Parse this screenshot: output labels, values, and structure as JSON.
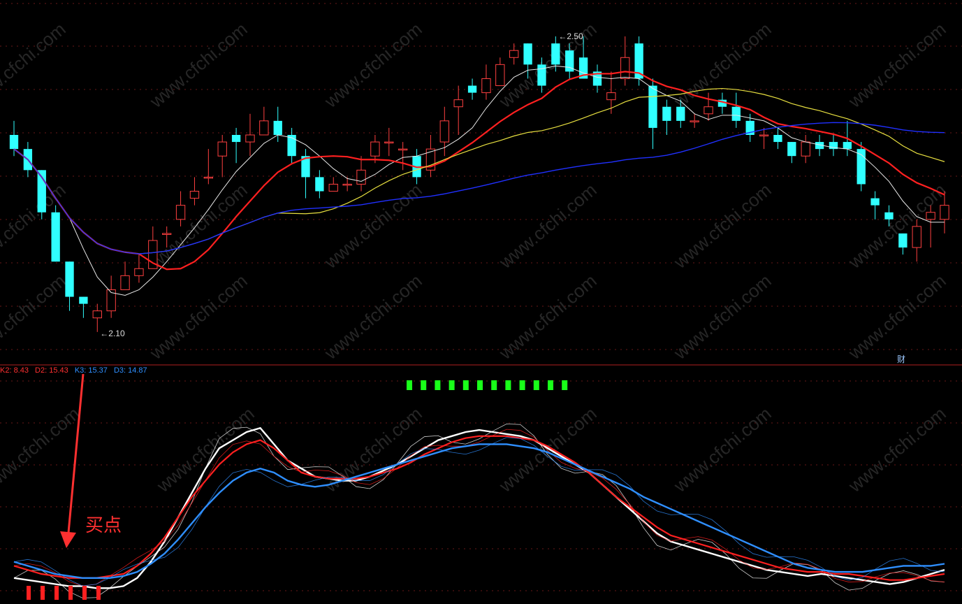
{
  "chart_data": [
    {
      "type": "candlestick",
      "panel": "price",
      "annotations": {
        "high_label": "2.50",
        "low_label": "2.10",
        "corner_badge": "财"
      },
      "ylim": [
        2.08,
        2.53
      ],
      "candles": [
        [
          2.38,
          2.36,
          2.4,
          2.35
        ],
        [
          2.36,
          2.33,
          2.37,
          2.32
        ],
        [
          2.33,
          2.27,
          2.33,
          2.26
        ],
        [
          2.27,
          2.2,
          2.28,
          2.2
        ],
        [
          2.2,
          2.15,
          2.2,
          2.13
        ],
        [
          2.15,
          2.14,
          2.15,
          2.12
        ],
        [
          2.12,
          2.13,
          2.14,
          2.1
        ],
        [
          2.13,
          2.16,
          2.18,
          2.12
        ],
        [
          2.16,
          2.18,
          2.2,
          2.16
        ],
        [
          2.18,
          2.19,
          2.21,
          2.17
        ],
        [
          2.19,
          2.23,
          2.25,
          2.19
        ],
        [
          2.24,
          2.24,
          2.25,
          2.22
        ],
        [
          2.26,
          2.28,
          2.3,
          2.25
        ],
        [
          2.29,
          2.3,
          2.32,
          2.28
        ],
        [
          2.32,
          2.32,
          2.36,
          2.31
        ],
        [
          2.35,
          2.37,
          2.38,
          2.32
        ],
        [
          2.38,
          2.37,
          2.39,
          2.34
        ],
        [
          2.37,
          2.38,
          2.41,
          2.35
        ],
        [
          2.38,
          2.4,
          2.42,
          2.38
        ],
        [
          2.4,
          2.38,
          2.42,
          2.37
        ],
        [
          2.38,
          2.35,
          2.39,
          2.34
        ],
        [
          2.35,
          2.32,
          2.36,
          2.29
        ],
        [
          2.32,
          2.3,
          2.33,
          2.29
        ],
        [
          2.3,
          2.31,
          2.32,
          2.3
        ],
        [
          2.31,
          2.31,
          2.32,
          2.3
        ],
        [
          2.31,
          2.33,
          2.35,
          2.3
        ],
        [
          2.35,
          2.37,
          2.38,
          2.34
        ],
        [
          2.37,
          2.37,
          2.39,
          2.35
        ],
        [
          2.36,
          2.36,
          2.37,
          2.33
        ],
        [
          2.35,
          2.32,
          2.36,
          2.31
        ],
        [
          2.33,
          2.36,
          2.38,
          2.32
        ],
        [
          2.37,
          2.4,
          2.42,
          2.35
        ],
        [
          2.42,
          2.43,
          2.45,
          2.38
        ],
        [
          2.45,
          2.44,
          2.46,
          2.43
        ],
        [
          2.44,
          2.46,
          2.48,
          2.43
        ],
        [
          2.45,
          2.48,
          2.49,
          2.45
        ],
        [
          2.49,
          2.5,
          2.51,
          2.48
        ],
        [
          2.51,
          2.48,
          2.51,
          2.46
        ],
        [
          2.48,
          2.45,
          2.49,
          2.44
        ],
        [
          2.51,
          2.48,
          2.52,
          2.47
        ],
        [
          2.5,
          2.47,
          2.51,
          2.46
        ],
        [
          2.49,
          2.46,
          2.52,
          2.46
        ],
        [
          2.47,
          2.45,
          2.48,
          2.44
        ],
        [
          2.43,
          2.44,
          2.47,
          2.41
        ],
        [
          2.46,
          2.49,
          2.52,
          2.45
        ],
        [
          2.51,
          2.46,
          2.52,
          2.45
        ],
        [
          2.45,
          2.39,
          2.46,
          2.36
        ],
        [
          2.42,
          2.4,
          2.43,
          2.38
        ],
        [
          2.42,
          2.4,
          2.43,
          2.39
        ],
        [
          2.4,
          2.4,
          2.41,
          2.39
        ],
        [
          2.41,
          2.42,
          2.44,
          2.4
        ],
        [
          2.43,
          2.42,
          2.44,
          2.41
        ],
        [
          2.42,
          2.4,
          2.44,
          2.39
        ],
        [
          2.4,
          2.38,
          2.41,
          2.37
        ],
        [
          2.38,
          2.38,
          2.39,
          2.36
        ],
        [
          2.38,
          2.37,
          2.39,
          2.36
        ],
        [
          2.37,
          2.35,
          2.37,
          2.34
        ],
        [
          2.35,
          2.37,
          2.38,
          2.34
        ],
        [
          2.37,
          2.36,
          2.38,
          2.35
        ],
        [
          2.37,
          2.36,
          2.38,
          2.35
        ],
        [
          2.37,
          2.36,
          2.4,
          2.35
        ],
        [
          2.36,
          2.31,
          2.37,
          2.3
        ],
        [
          2.29,
          2.28,
          2.3,
          2.26
        ],
        [
          2.27,
          2.26,
          2.28,
          2.25
        ],
        [
          2.24,
          2.22,
          2.24,
          2.21
        ],
        [
          2.22,
          2.25,
          2.26,
          2.2
        ],
        [
          2.26,
          2.27,
          2.28,
          2.22
        ],
        [
          2.26,
          2.28,
          2.3,
          2.24
        ]
      ]
    },
    {
      "type": "line",
      "panel": "oscillator",
      "legend": [
        {
          "text": "K2: 8.43",
          "color": "#ff3030"
        },
        {
          "text": "D2: 15.43",
          "color": "#ff3030"
        },
        {
          "text": "K3: 15.37",
          "color": "#2f8fff"
        },
        {
          "text": "D3: 14.87",
          "color": "#2f8fff"
        }
      ],
      "ylim": [
        0,
        100
      ],
      "series": [
        {
          "values": [
            8,
            7,
            6,
            5,
            4,
            4,
            3,
            3,
            4,
            8,
            16,
            26,
            38,
            50,
            62,
            72,
            76,
            80,
            82,
            74,
            66,
            62,
            58,
            57,
            56,
            56,
            58,
            61,
            64,
            68,
            72,
            76,
            78,
            80,
            81,
            80,
            79,
            78,
            76,
            72,
            68,
            64,
            60,
            54,
            48,
            42,
            36,
            30,
            26,
            24,
            22,
            20,
            18,
            16,
            14,
            12,
            11,
            10,
            9,
            10,
            9,
            8,
            7,
            6,
            5,
            6,
            8,
            10,
            12
          ]
        },
        {
          "values": [
            14,
            12,
            10,
            9,
            8,
            8,
            8,
            9,
            10,
            14,
            20,
            28,
            38,
            48,
            56,
            64,
            70,
            74,
            76,
            72,
            66,
            60,
            58,
            57,
            57,
            57,
            58,
            60,
            62,
            65,
            69,
            72,
            75,
            77,
            78,
            78,
            78,
            77,
            76,
            73,
            69,
            65,
            60,
            54,
            48,
            43,
            38,
            33,
            29,
            27,
            25,
            23,
            21,
            19,
            17,
            15,
            13,
            12,
            11,
            11,
            10,
            10,
            9,
            8,
            7,
            7,
            8,
            9,
            10
          ]
        },
        {
          "values": [
            16,
            14,
            12,
            10,
            9,
            8,
            8,
            8,
            9,
            11,
            15,
            20,
            27,
            35,
            43,
            50,
            56,
            60,
            62,
            60,
            56,
            54,
            53,
            54,
            56,
            58,
            60,
            62,
            64,
            66,
            68,
            70,
            72,
            73,
            74,
            74,
            74,
            73,
            72,
            70,
            67,
            64,
            61,
            58,
            55,
            52,
            48,
            45,
            42,
            39,
            36,
            33,
            30,
            27,
            24,
            21,
            18,
            15,
            13,
            12,
            11,
            11,
            11,
            12,
            13,
            14,
            14,
            14,
            15
          ]
        }
      ],
      "markers": {
        "buy_count": 6,
        "sell_count": 12,
        "buy_text": "买点"
      }
    }
  ],
  "watermark": "www.cfchi.com"
}
